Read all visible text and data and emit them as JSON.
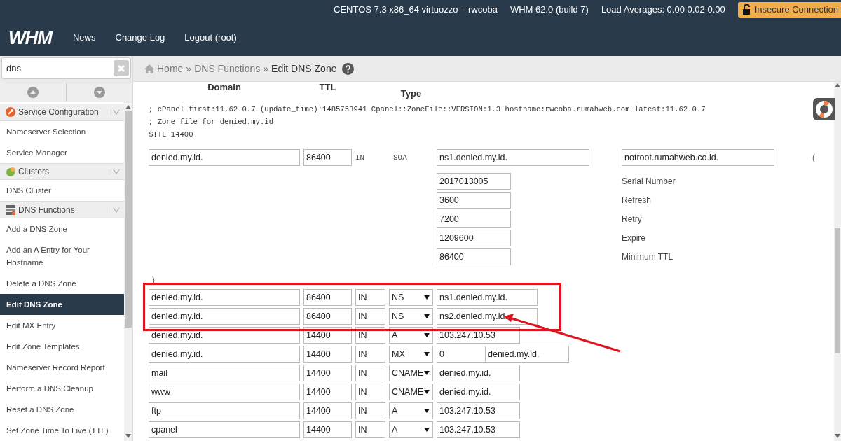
{
  "top_bar": {
    "server": "CENTOS 7.3 x86_64 virtuozzo – rwcoba",
    "version": "WHM 62.0 (build 7)",
    "load": "Load Averages: 0.00 0.02 0.00",
    "security_badge": "Insecure Connection"
  },
  "nav": {
    "logo": "WHM",
    "links": [
      "News",
      "Change Log",
      "Logout (root)"
    ]
  },
  "sidebar": {
    "search": {
      "value": "dns"
    },
    "groups": [
      {
        "label": "Service Configuration",
        "expanded": true,
        "children": [
          {
            "label": "Nameserver Selection",
            "selected": false
          },
          {
            "label": "Service Manager",
            "selected": false
          }
        ]
      },
      {
        "label": "Clusters",
        "expanded": true,
        "children": [
          {
            "label": "DNS Cluster",
            "selected": false
          }
        ]
      },
      {
        "label": "DNS Functions",
        "expanded": true,
        "children": [
          {
            "label": "Add a DNS Zone",
            "selected": false
          },
          {
            "label": "Add an A Entry for Your Hostname",
            "selected": false
          },
          {
            "label": "Delete a DNS Zone",
            "selected": false
          },
          {
            "label": "Edit DNS Zone",
            "selected": true
          },
          {
            "label": "Edit MX Entry",
            "selected": false
          },
          {
            "label": "Edit Zone Templates",
            "selected": false
          },
          {
            "label": "Nameserver Record Report",
            "selected": false
          },
          {
            "label": "Perform a DNS Cleanup",
            "selected": false
          },
          {
            "label": "Reset a DNS Zone",
            "selected": false
          },
          {
            "label": "Set Zone Time To Live (TTL)",
            "selected": false
          }
        ]
      }
    ]
  },
  "breadcrumb": {
    "items": [
      "Home",
      "DNS Functions",
      "Edit DNS Zone"
    ],
    "separators": [
      "»",
      "»"
    ]
  },
  "table": {
    "columns": [
      "Domain",
      "TTL",
      "Type"
    ],
    "comments": [
      "; cPanel first:11.62.0.7 (update_time):1485753941 Cpanel::ZoneFile::VERSION:1.3 hostname:rwcoba.rumahweb.com latest:11.62.0.7",
      "; Zone file for denied.my.id",
      "$TTL 14400"
    ],
    "soa": {
      "name": "denied.my.id.",
      "ttl": "86400",
      "class": "IN",
      "type": "SOA",
      "primary_ns": "ns1.denied.my.id.",
      "contact": "notroot.rumahweb.co.id.",
      "open_paren": "(",
      "fields": [
        {
          "value": "2017013005",
          "label": "Serial Number"
        },
        {
          "value": "3600",
          "label": "Refresh"
        },
        {
          "value": "7200",
          "label": "Retry"
        },
        {
          "value": "1209600",
          "label": "Expire"
        },
        {
          "value": "86400",
          "label": "Minimum TTL"
        }
      ],
      "close_paren": ")"
    },
    "records": [
      {
        "name": "denied.my.id.",
        "ttl": "86400",
        "class": "IN",
        "type": "NS",
        "data": [
          "ns1.denied.my.id."
        ],
        "highlighted": true
      },
      {
        "name": "denied.my.id.",
        "ttl": "86400",
        "class": "IN",
        "type": "NS",
        "data": [
          "ns2.denied.my.id."
        ],
        "highlighted": true
      },
      {
        "name": "denied.my.id.",
        "ttl": "14400",
        "class": "IN",
        "type": "A",
        "data": [
          "103.247.10.53"
        ],
        "highlighted": false
      },
      {
        "name": "denied.my.id.",
        "ttl": "14400",
        "class": "IN",
        "type": "MX",
        "data": [
          "0",
          "denied.my.id."
        ],
        "highlighted": false
      },
      {
        "name": "mail",
        "ttl": "14400",
        "class": "IN",
        "type": "CNAME",
        "data": [
          "denied.my.id."
        ],
        "highlighted": false
      },
      {
        "name": "www",
        "ttl": "14400",
        "class": "IN",
        "type": "CNAME",
        "data": [
          "denied.my.id."
        ],
        "highlighted": false
      },
      {
        "name": "ftp",
        "ttl": "14400",
        "class": "IN",
        "type": "A",
        "data": [
          "103.247.10.53"
        ],
        "highlighted": false
      },
      {
        "name": "cpanel",
        "ttl": "14400",
        "class": "IN",
        "type": "A",
        "data": [
          "103.247.10.53"
        ],
        "highlighted": false
      }
    ]
  }
}
